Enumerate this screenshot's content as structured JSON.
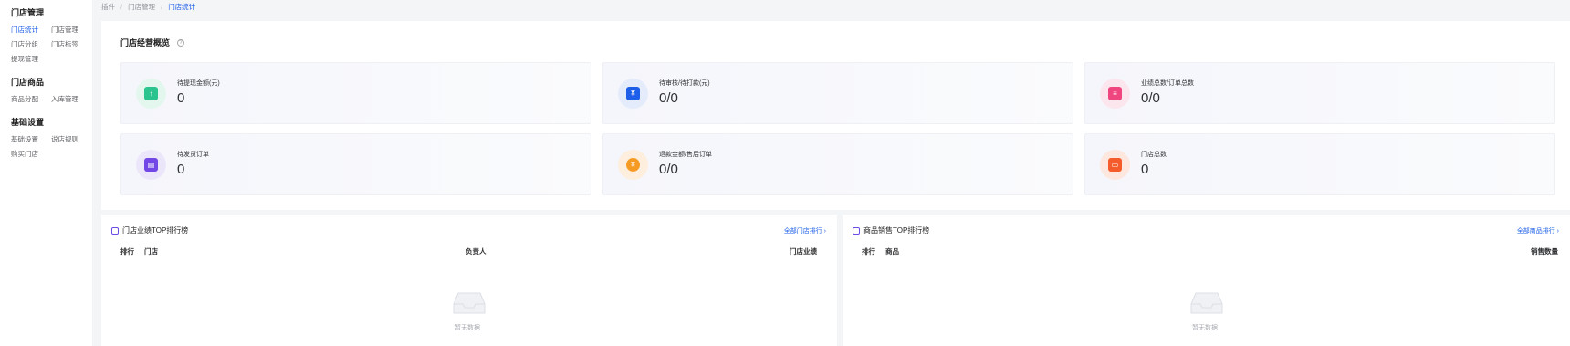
{
  "sidebar": {
    "groups": [
      {
        "title": "门店管理",
        "items": [
          "门店统计",
          "门店管理",
          "门店分组",
          "门店标签",
          "提现管理"
        ]
      },
      {
        "title": "门店商品",
        "items": [
          "商品分配",
          "入库管理"
        ]
      },
      {
        "title": "基础设置",
        "items": [
          "基础设置",
          "说店规则",
          "购买门店"
        ]
      }
    ],
    "active_item": "门店统计"
  },
  "breadcrumb": {
    "items": [
      "插件",
      "门店管理",
      "门店统计"
    ],
    "separator": "/"
  },
  "overview": {
    "title": "门店经营概览",
    "help_glyph": "?",
    "stats": [
      {
        "label": "待提现金额(元)",
        "value": "0",
        "icon": "withdraw-icon",
        "color": "#2bc48f",
        "bg": "#e4f7ee",
        "glyph": "↑"
      },
      {
        "label": "待审核/待打款(元)",
        "value": "0/0",
        "icon": "wallet-icon",
        "color": "#1d5fe8",
        "bg": "#e4ebfb",
        "glyph": "¥"
      },
      {
        "label": "业绩总数/订单总数",
        "value": "0/0",
        "icon": "order-icon",
        "color": "#ef4680",
        "bg": "#fce6ee",
        "glyph": "≡"
      },
      {
        "label": "待发货订单",
        "value": "0",
        "icon": "shipping-icon",
        "color": "#7247e6",
        "bg": "#ece6fb",
        "glyph": "▤"
      },
      {
        "label": "退款金额/售后订单",
        "value": "0/0",
        "icon": "refund-icon",
        "color": "#f59a23",
        "bg": "#fdeedd",
        "glyph": "¥"
      },
      {
        "label": "门店总数",
        "value": "0",
        "icon": "store-icon",
        "color": "#f45c2c",
        "bg": "#fde7df",
        "glyph": "▭"
      }
    ]
  },
  "store_rank": {
    "title": "门店业绩TOP排行榜",
    "link": "全部门店排行 ›",
    "columns": [
      "排行",
      "门店",
      "负责人",
      "门店业绩"
    ],
    "empty": "暂无数据"
  },
  "product_rank": {
    "title": "商品销售TOP排行榜",
    "link": "全部商品排行 ›",
    "columns": [
      "排行",
      "商品",
      "销售数量"
    ],
    "empty": "暂无数据"
  }
}
